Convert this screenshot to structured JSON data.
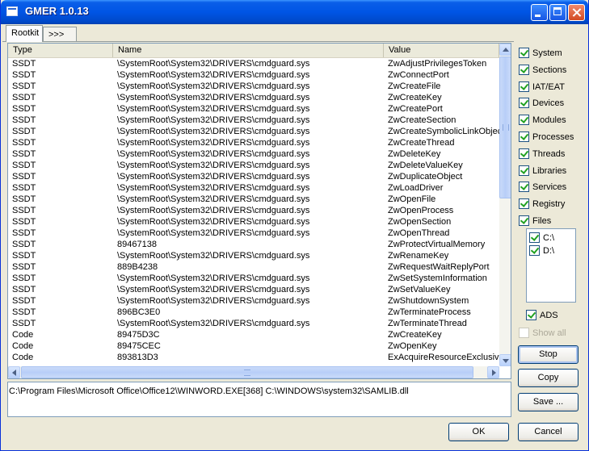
{
  "window": {
    "title": "GMER 1.0.13"
  },
  "tabs": [
    {
      "label": "Rootkit"
    },
    {
      "label": ">>>"
    }
  ],
  "list": {
    "columns": [
      "Type",
      "Name",
      "Value"
    ],
    "rows": [
      [
        "SSDT",
        "\\SystemRoot\\System32\\DRIVERS\\cmdguard.sys",
        "ZwAdjustPrivilegesToken"
      ],
      [
        "SSDT",
        "\\SystemRoot\\System32\\DRIVERS\\cmdguard.sys",
        "ZwConnectPort"
      ],
      [
        "SSDT",
        "\\SystemRoot\\System32\\DRIVERS\\cmdguard.sys",
        "ZwCreateFile"
      ],
      [
        "SSDT",
        "\\SystemRoot\\System32\\DRIVERS\\cmdguard.sys",
        "ZwCreateKey"
      ],
      [
        "SSDT",
        "\\SystemRoot\\System32\\DRIVERS\\cmdguard.sys",
        "ZwCreatePort"
      ],
      [
        "SSDT",
        "\\SystemRoot\\System32\\DRIVERS\\cmdguard.sys",
        "ZwCreateSection"
      ],
      [
        "SSDT",
        "\\SystemRoot\\System32\\DRIVERS\\cmdguard.sys",
        "ZwCreateSymbolicLinkObjec"
      ],
      [
        "SSDT",
        "\\SystemRoot\\System32\\DRIVERS\\cmdguard.sys",
        "ZwCreateThread"
      ],
      [
        "SSDT",
        "\\SystemRoot\\System32\\DRIVERS\\cmdguard.sys",
        "ZwDeleteKey"
      ],
      [
        "SSDT",
        "\\SystemRoot\\System32\\DRIVERS\\cmdguard.sys",
        "ZwDeleteValueKey"
      ],
      [
        "SSDT",
        "\\SystemRoot\\System32\\DRIVERS\\cmdguard.sys",
        "ZwDuplicateObject"
      ],
      [
        "SSDT",
        "\\SystemRoot\\System32\\DRIVERS\\cmdguard.sys",
        "ZwLoadDriver"
      ],
      [
        "SSDT",
        "\\SystemRoot\\System32\\DRIVERS\\cmdguard.sys",
        "ZwOpenFile"
      ],
      [
        "SSDT",
        "\\SystemRoot\\System32\\DRIVERS\\cmdguard.sys",
        "ZwOpenProcess"
      ],
      [
        "SSDT",
        "\\SystemRoot\\System32\\DRIVERS\\cmdguard.sys",
        "ZwOpenSection"
      ],
      [
        "SSDT",
        "\\SystemRoot\\System32\\DRIVERS\\cmdguard.sys",
        "ZwOpenThread"
      ],
      [
        "SSDT",
        "89467138",
        "ZwProtectVirtualMemory"
      ],
      [
        "SSDT",
        "\\SystemRoot\\System32\\DRIVERS\\cmdguard.sys",
        "ZwRenameKey"
      ],
      [
        "SSDT",
        "889B4238",
        "ZwRequestWaitReplyPort"
      ],
      [
        "SSDT",
        "\\SystemRoot\\System32\\DRIVERS\\cmdguard.sys",
        "ZwSetSystemInformation"
      ],
      [
        "SSDT",
        "\\SystemRoot\\System32\\DRIVERS\\cmdguard.sys",
        "ZwSetValueKey"
      ],
      [
        "SSDT",
        "\\SystemRoot\\System32\\DRIVERS\\cmdguard.sys",
        "ZwShutdownSystem"
      ],
      [
        "SSDT",
        "896BC3E0",
        "ZwTerminateProcess"
      ],
      [
        "SSDT",
        "\\SystemRoot\\System32\\DRIVERS\\cmdguard.sys",
        "ZwTerminateThread"
      ],
      [
        "Code",
        "89475D3C",
        "ZwCreateKey"
      ],
      [
        "Code",
        "89475CEC",
        "ZwOpenKey"
      ],
      [
        "Code",
        "893813D3",
        "ExAcquireResourceExclusive"
      ]
    ]
  },
  "status_path": "C:\\Program Files\\Microsoft Office\\Office12\\WINWORD.EXE[368] C:\\WINDOWS\\system32\\SAMLIB.dll",
  "options": [
    {
      "label": "System",
      "checked": true
    },
    {
      "label": "Sections",
      "checked": true
    },
    {
      "label": "IAT/EAT",
      "checked": true
    },
    {
      "label": "Devices",
      "checked": true
    },
    {
      "label": "Modules",
      "checked": true
    },
    {
      "label": "Processes",
      "checked": true
    },
    {
      "label": "Threads",
      "checked": true
    },
    {
      "label": "Libraries",
      "checked": true
    },
    {
      "label": "Services",
      "checked": true
    },
    {
      "label": "Registry",
      "checked": true
    },
    {
      "label": "Files",
      "checked": true
    }
  ],
  "drives": [
    {
      "label": "C:\\",
      "checked": true
    },
    {
      "label": "D:\\",
      "checked": true
    }
  ],
  "ads": {
    "label": "ADS",
    "checked": true
  },
  "show_all": {
    "label": "Show all",
    "checked": false,
    "disabled": true
  },
  "buttons": {
    "stop": "Stop",
    "copy": "Copy",
    "save": "Save ...",
    "ok": "OK",
    "cancel": "Cancel"
  }
}
